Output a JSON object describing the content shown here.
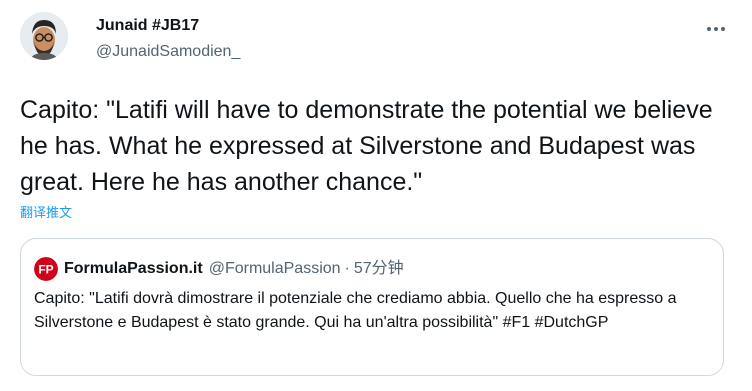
{
  "tweet": {
    "author": {
      "display_name": "Junaid #JB17",
      "handle": "@JunaidSamodien_"
    },
    "more_icon": "more-horizontal-icon",
    "text": "Capito: \"Latifi will have to demonstrate the potential we believe he has. What he expressed at Silverstone and Budapest was great. Here he has another chance.\"",
    "translate_label": "翻译推文"
  },
  "quote": {
    "author": {
      "display_name": "FormulaPassion.it",
      "handle": "@FormulaPassion",
      "separator": "·",
      "time": "57分钟"
    },
    "logo_text": "FP",
    "text": "Capito: \"Latifi dovrà dimostrare il potenziale che crediamo abbia. Quello che ha espresso a Silverstone e Budapest è stato grande. Qui ha un'altra possibilità\" #F1 #DutchGP"
  },
  "colors": {
    "accent": "#1d9bf0",
    "secondary_text": "#536471",
    "border": "#cfd9de",
    "fp_red": "#d0021b"
  }
}
